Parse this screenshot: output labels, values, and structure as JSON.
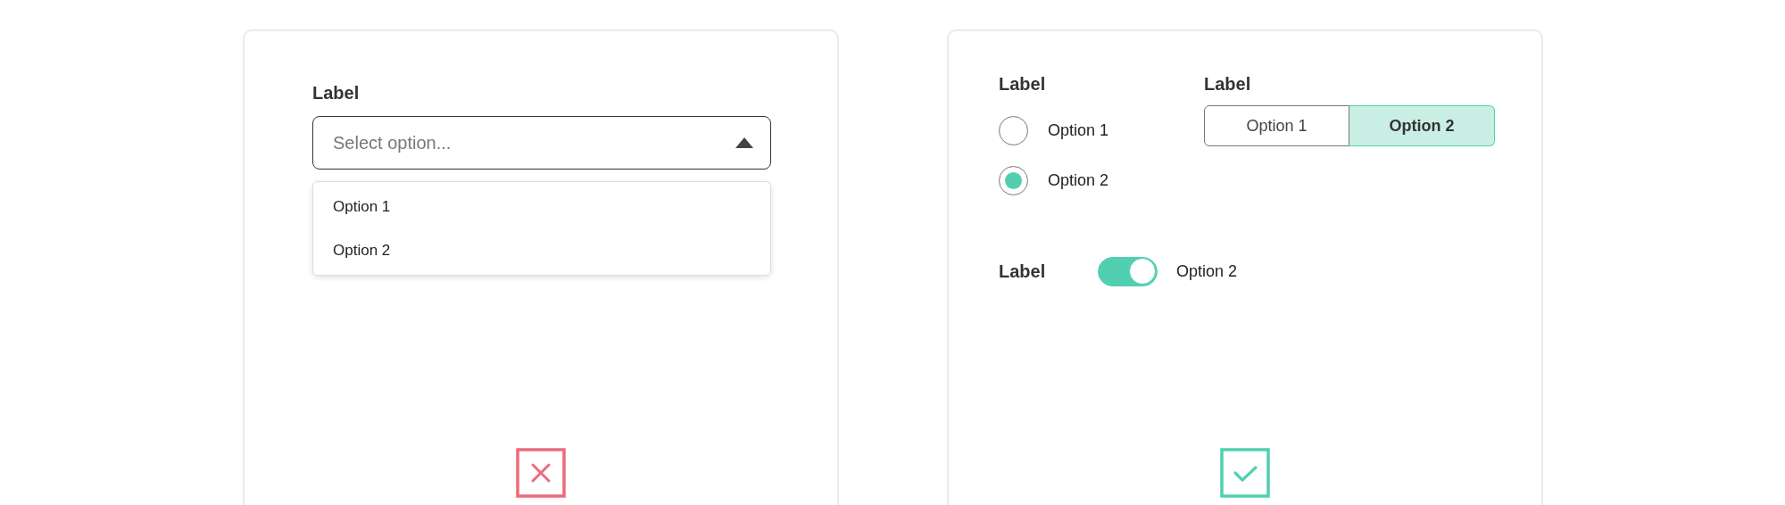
{
  "left_panel": {
    "verdict": {
      "kind": "wrong"
    },
    "select": {
      "label": "Label",
      "placeholder": "Select option...",
      "expanded": true,
      "options": [
        "Option 1",
        "Option 2"
      ]
    }
  },
  "right_panel": {
    "verdict": {
      "kind": "right"
    },
    "radio_group": {
      "label": "Label",
      "options": [
        {
          "label": "Option 1",
          "selected": false
        },
        {
          "label": "Option 2",
          "selected": true
        }
      ]
    },
    "segmented": {
      "label": "Label",
      "options": [
        {
          "label": "Option 1",
          "selected": false
        },
        {
          "label": "Option 2",
          "selected": true
        }
      ]
    },
    "toggle": {
      "label": "Label",
      "on": true,
      "text": "Option 2"
    }
  }
}
